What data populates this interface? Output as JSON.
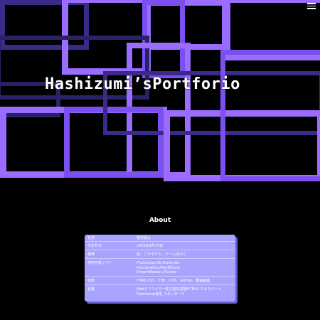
{
  "hero": {
    "title": "Hashizumi’sPortforio",
    "menu_icon": "hamburger-menu-icon"
  },
  "about": {
    "heading": "About",
    "rows": [
      {
        "label": "名前",
        "value": "橋住健太"
      },
      {
        "label": "生年月日",
        "value": "2005年4月19日"
      },
      {
        "label": "趣味",
        "value": "鉄、プラモデル、ゲーム(DLC)"
      },
      {
        "label": "使用可能ソフト",
        "value": "Photoshop,XD,Illustrator",
        "value2": "PremierePro,AfterEffects",
        "value3": "DreamWeaver,VScode"
      },
      {
        "label": "技能",
        "value": "HTML/CSS、PHP、CMS、GitHub、動画編集"
      },
      {
        "label": "資格",
        "value": "Webクリエイター能力認定試験HTML5 エキスパート",
        "value2": "Photoshop検定 スタンダード"
      }
    ]
  },
  "colors": {
    "background": "#000000",
    "frame_bright": "#9a6cff",
    "card_bg": "#a7a3ff"
  }
}
